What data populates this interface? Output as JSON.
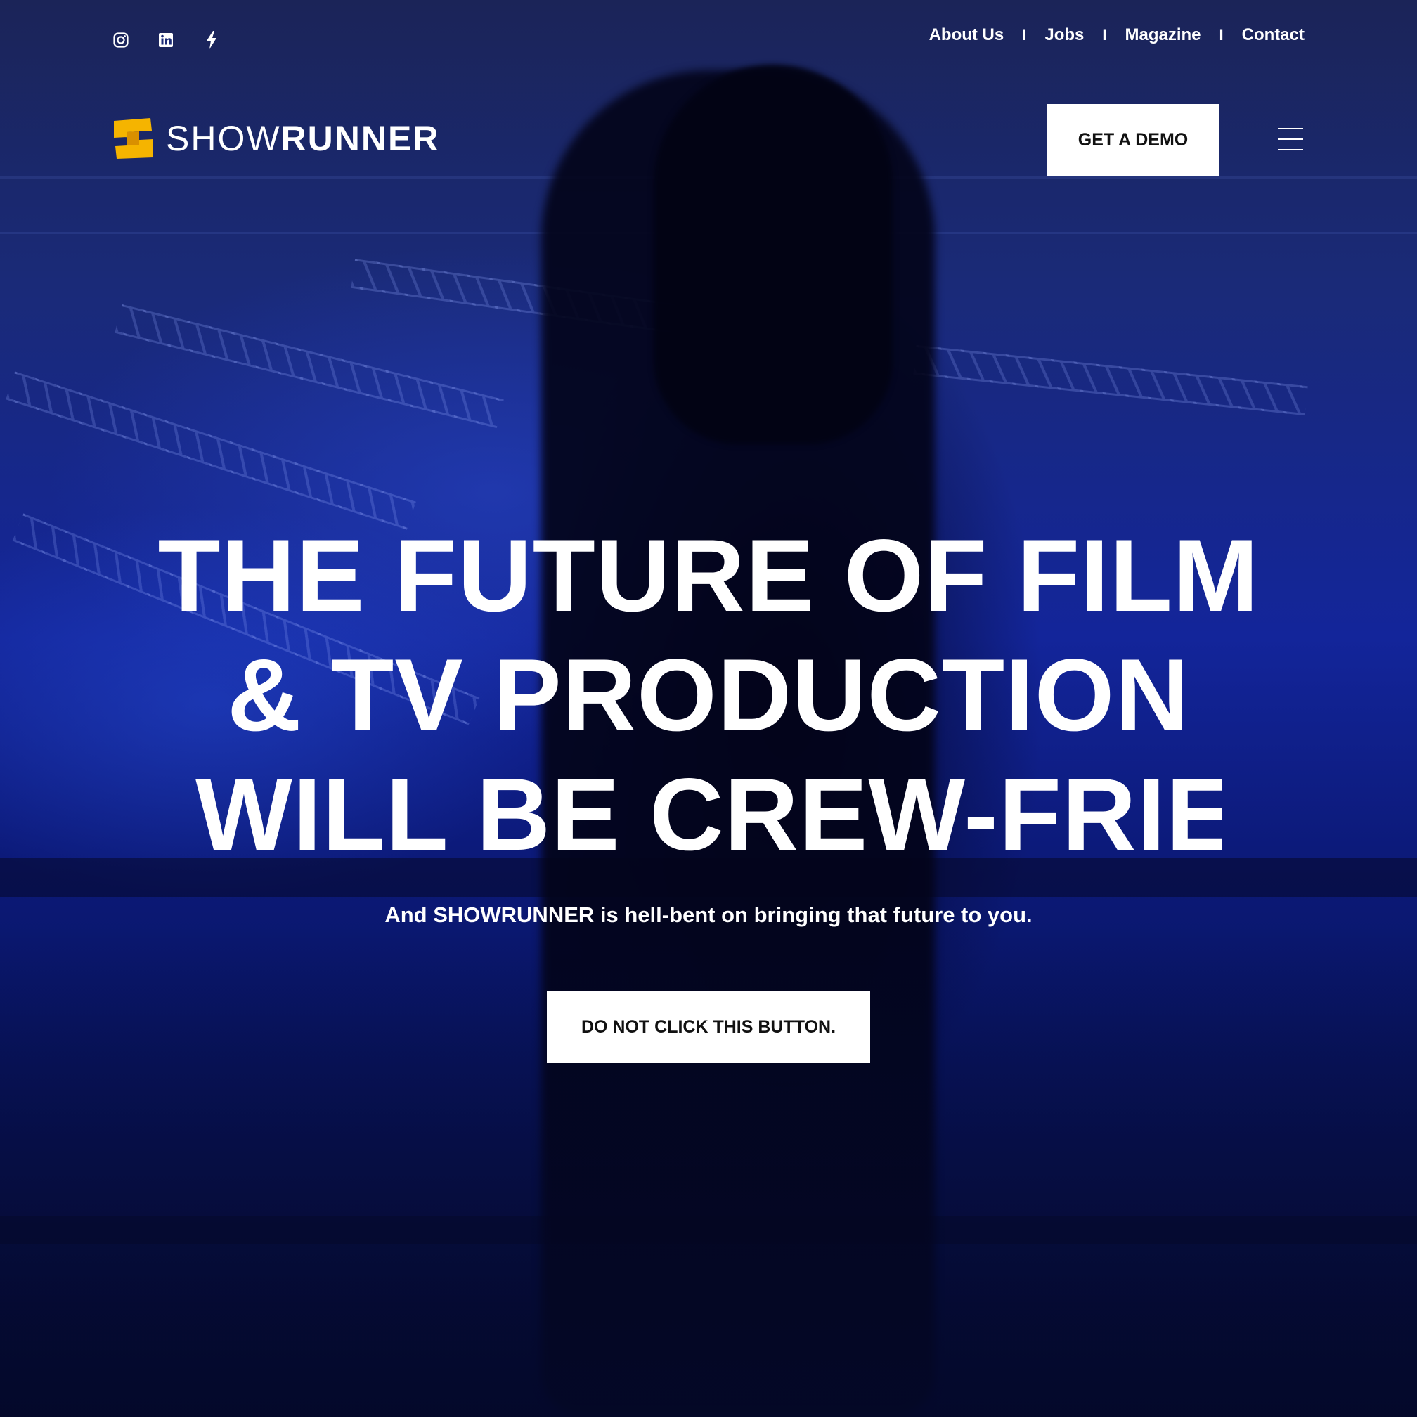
{
  "social": [
    {
      "name": "instagram-icon"
    },
    {
      "name": "linkedin-icon"
    },
    {
      "name": "lightning-icon"
    }
  ],
  "top_nav": {
    "items": [
      "About Us",
      "Jobs",
      "Magazine",
      "Contact"
    ],
    "separator": "I"
  },
  "header": {
    "logo": {
      "thin": "SHOW",
      "bold": "RUNNER"
    },
    "demo_label": "GET A DEMO",
    "menu_icon": "hamburger-icon"
  },
  "hero": {
    "title_lines": [
      "THE FUTURE OF FILM",
      "& TV PRODUCTION",
      "WILL BE CREW-FRIEI"
    ],
    "subtitle": "And SHOWRUNNER is hell-bent on bringing that future to you.",
    "cta_label": "DO NOT CLICK THIS BUTTON."
  },
  "colors": {
    "logo_accent": "#f5b400",
    "button_bg": "#ffffff",
    "button_text": "#111111",
    "text": "#ffffff",
    "overlay_blue": "#13259a"
  }
}
